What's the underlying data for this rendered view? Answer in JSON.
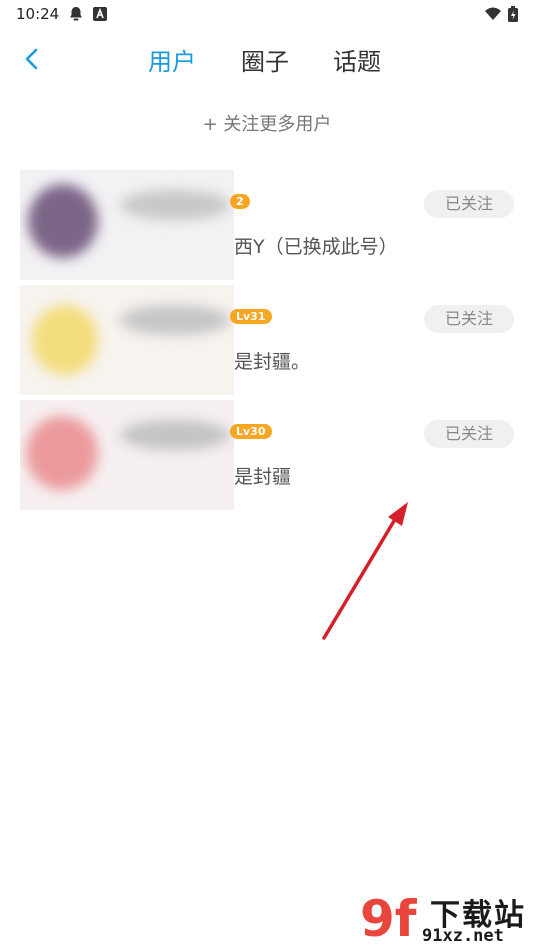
{
  "status_bar": {
    "time": "10:24"
  },
  "nav": {
    "tabs": [
      {
        "label": "用户",
        "active": true
      },
      {
        "label": "圈子",
        "active": false
      },
      {
        "label": "话题",
        "active": false
      }
    ]
  },
  "add_more": "+ 关注更多用户",
  "users": [
    {
      "level": "2",
      "desc": "西Y（已换成此号）",
      "follow": "已关注"
    },
    {
      "level": "Lv31",
      "desc": "是封疆。",
      "follow": "已关注"
    },
    {
      "level": "Lv30",
      "desc": "是封疆",
      "follow": "已关注"
    }
  ],
  "watermark": {
    "brand": "下载站",
    "url": "91xz.net"
  },
  "colors": {
    "accent": "#1a9be0",
    "badge": "#f6a623",
    "arrow": "#d4202a"
  }
}
